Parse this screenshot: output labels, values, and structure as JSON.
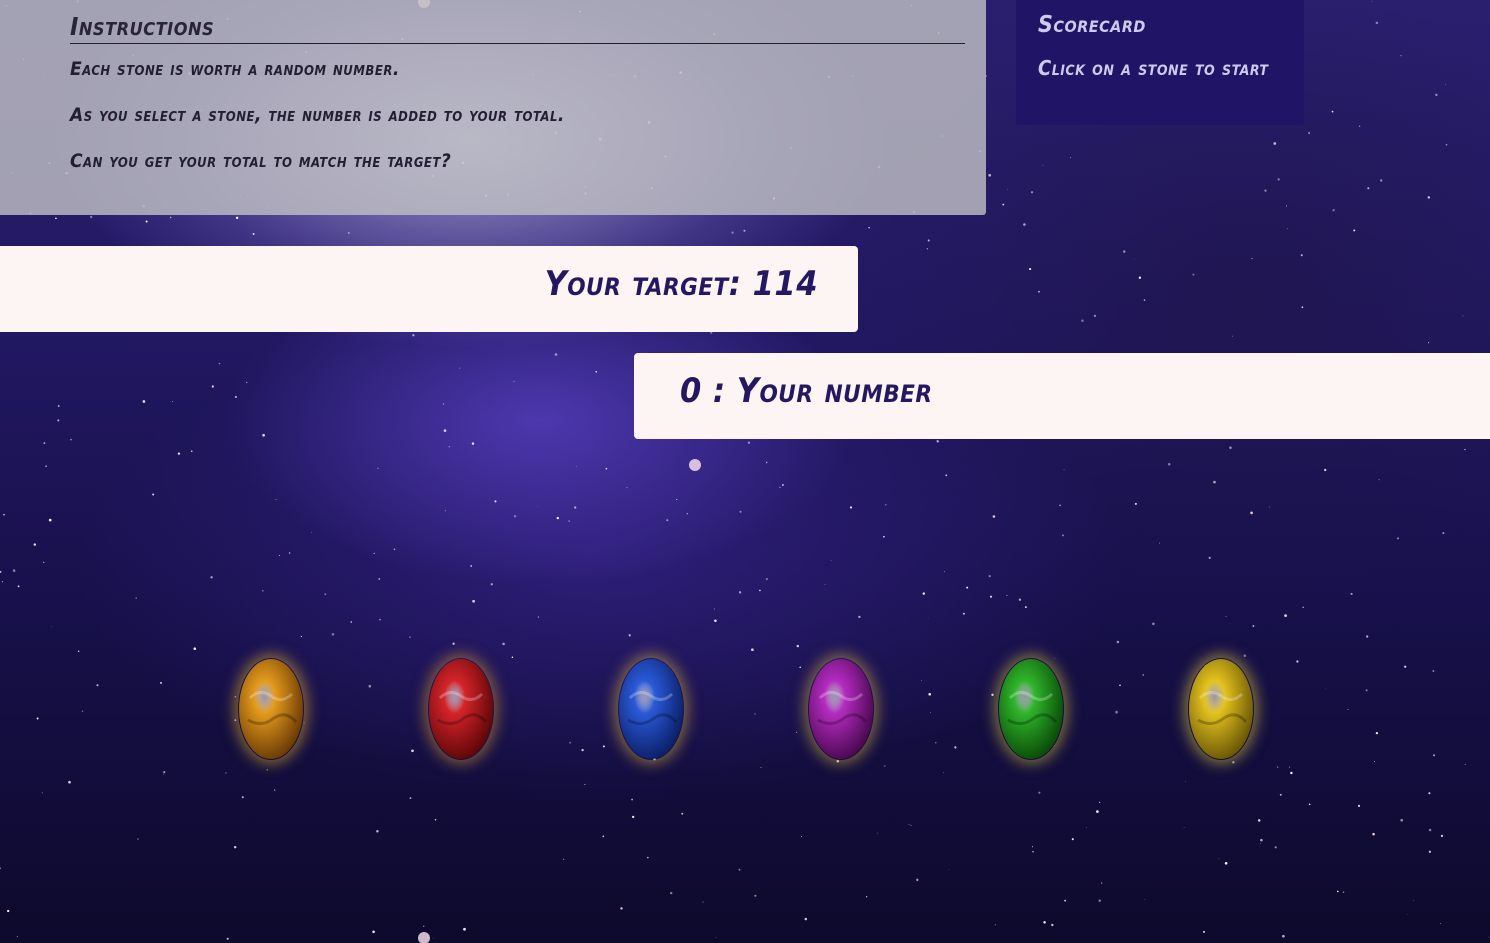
{
  "instructions": {
    "title": "Instructions",
    "lines": [
      "Each stone is worth a random number.",
      "As you select a stone, the number is added to your total.",
      "Can you get your total to match the target?"
    ]
  },
  "scorecard": {
    "title": "Scorecard",
    "message": "Click on a stone to start"
  },
  "target": {
    "label": "Your target: 114",
    "value": 114
  },
  "player": {
    "label": "0 : Your number",
    "value": 0
  },
  "stones": [
    {
      "name": "orange-stone",
      "color": "#e39a1c",
      "dark": "#6b3a05",
      "glow": "#e6b52a"
    },
    {
      "name": "red-stone",
      "color": "#d4242a",
      "dark": "#5e0608",
      "glow": "#d89a2a"
    },
    {
      "name": "blue-stone",
      "color": "#2a5ad8",
      "dark": "#0b1f66",
      "glow": "#d8b23a"
    },
    {
      "name": "purple-stone",
      "color": "#b42cc0",
      "dark": "#4a0850",
      "glow": "#d8b23a"
    },
    {
      "name": "green-stone",
      "color": "#2fb52a",
      "dark": "#0a4a08",
      "glow": "#d8c23a"
    },
    {
      "name": "yellow-stone",
      "color": "#e4c21e",
      "dark": "#6a5606",
      "glow": "#e4cf3a"
    }
  ]
}
